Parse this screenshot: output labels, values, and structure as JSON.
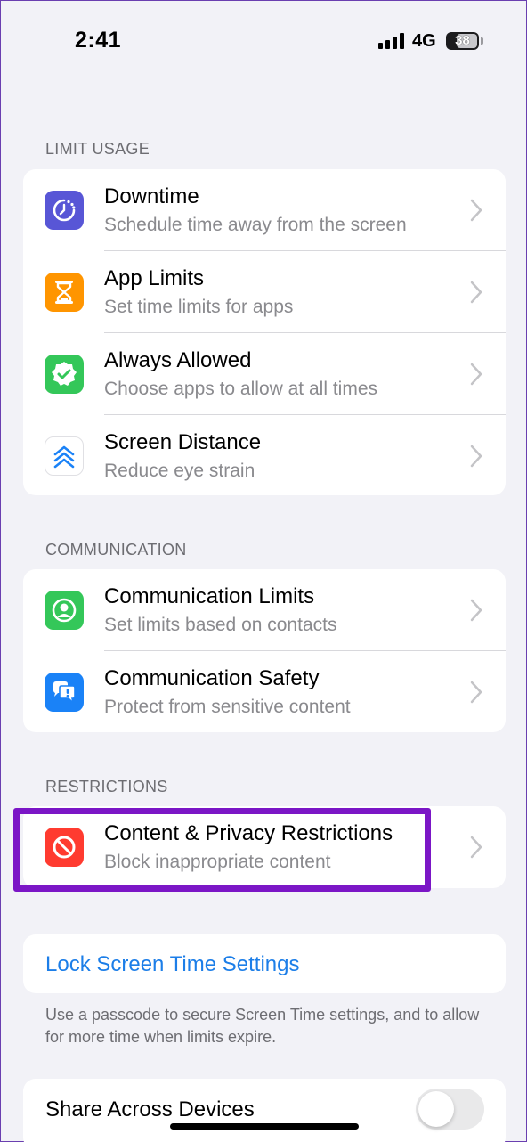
{
  "status_bar": {
    "time": "2:41",
    "network": "4G",
    "battery_level": "38"
  },
  "sections": {
    "limit_usage": {
      "header": "LIMIT USAGE",
      "items": [
        {
          "title": "Downtime",
          "subtitle": "Schedule time away from the screen",
          "icon": "downtime-icon",
          "color": "#5856d6"
        },
        {
          "title": "App Limits",
          "subtitle": "Set time limits for apps",
          "icon": "hourglass-icon",
          "color": "#ff9500"
        },
        {
          "title": "Always Allowed",
          "subtitle": "Choose apps to allow at all times",
          "icon": "checkmark-seal-icon",
          "color": "#34c759"
        },
        {
          "title": "Screen Distance",
          "subtitle": "Reduce eye strain",
          "icon": "chevrons-up-icon",
          "color": "#ffffff"
        }
      ]
    },
    "communication": {
      "header": "COMMUNICATION",
      "items": [
        {
          "title": "Communication Limits",
          "subtitle": "Set limits based on contacts",
          "icon": "person-circle-icon",
          "color": "#34c759"
        },
        {
          "title": "Communication Safety",
          "subtitle": "Protect from sensitive content",
          "icon": "chat-bubble-exclamation-icon",
          "color": "#1a82f7"
        }
      ]
    },
    "restrictions": {
      "header": "RESTRICTIONS",
      "items": [
        {
          "title": "Content & Privacy Restrictions",
          "subtitle": "Block inappropriate content",
          "icon": "prohibited-icon",
          "color": "#ff3b30"
        }
      ]
    }
  },
  "lock_screen_time": {
    "label": "Lock Screen Time Settings",
    "footnote": "Use a passcode to secure Screen Time settings, and to allow for more time when limits expire."
  },
  "share_across_devices": {
    "label": "Share Across Devices",
    "enabled": false
  },
  "colors": {
    "accent_link": "#1c7ee8",
    "highlight_border": "#7b16c6",
    "background": "#f2f2f7"
  }
}
